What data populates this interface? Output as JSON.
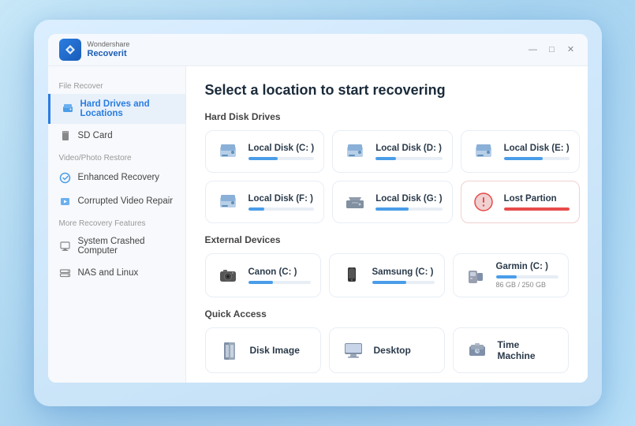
{
  "app": {
    "brand_top": "Wondershare",
    "brand_bottom": "Recoverit",
    "logo_char": "R"
  },
  "titlebar": {
    "minimize": "—",
    "maximize": "□",
    "close": "✕"
  },
  "sidebar": {
    "section_file": "File Recover",
    "item_hard_drives": "Hard Drives and Locations",
    "item_sd_card": "SD Card",
    "section_video": "Video/Photo Restore",
    "item_enhanced": "Enhanced Recovery",
    "item_corrupted": "Corrupted Video Repair",
    "section_more": "More Recovery Features",
    "item_system": "System Crashed Computer",
    "item_nas": "NAS and Linux"
  },
  "content": {
    "page_title": "Select a location to start recovering",
    "section_hdd": "Hard Disk Drives",
    "section_external": "External Devices",
    "section_quick": "Quick Access",
    "drives": [
      {
        "id": "c",
        "name": "Local Disk (C: )",
        "fill": 45,
        "color": "blue"
      },
      {
        "id": "d",
        "name": "Local Disk (D: )",
        "fill": 30,
        "color": "blue"
      },
      {
        "id": "e",
        "name": "Local Disk (E: )",
        "fill": 60,
        "color": "blue"
      },
      {
        "id": "f",
        "name": "Local Disk (F: )",
        "fill": 25,
        "color": "blue"
      },
      {
        "id": "g",
        "name": "Local Disk (G: )",
        "fill": 50,
        "color": "blue"
      },
      {
        "id": "lost",
        "name": "Lost Partion",
        "fill": 100,
        "color": "red"
      }
    ],
    "external": [
      {
        "id": "canon",
        "name": "Canon (C: )",
        "fill": 40,
        "color": "blue"
      },
      {
        "id": "samsung",
        "name": "Samsung (C: )",
        "fill": 55,
        "color": "blue"
      },
      {
        "id": "garmin",
        "name": "Garmin (C: )",
        "fill": 34,
        "color": "blue",
        "size": "86 GB / 250 GB"
      }
    ],
    "quick": [
      {
        "id": "disk-image",
        "name": "Disk Image"
      },
      {
        "id": "desktop",
        "name": "Desktop"
      },
      {
        "id": "time-machine",
        "name": "Time Machine"
      }
    ]
  }
}
